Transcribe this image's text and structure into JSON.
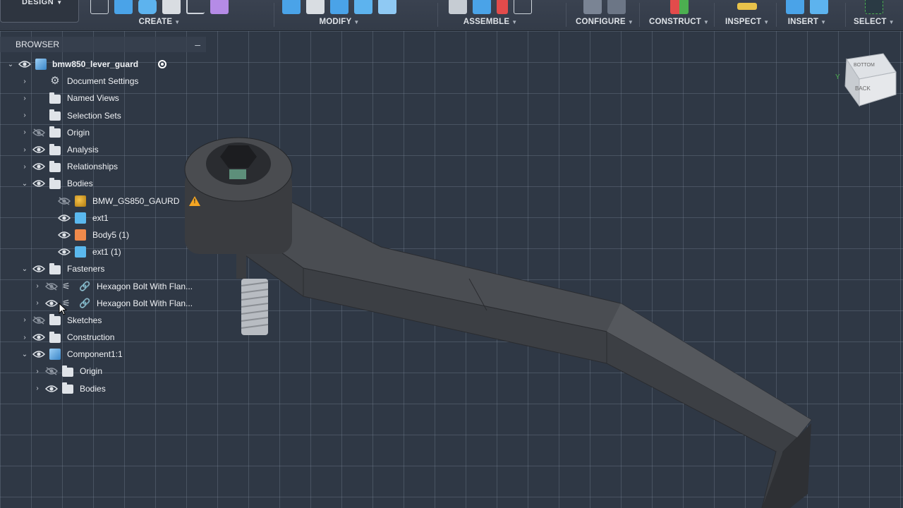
{
  "toolbar": {
    "design_label": "DESIGN",
    "groups": [
      {
        "label": "CREATE"
      },
      {
        "label": "MODIFY"
      },
      {
        "label": "ASSEMBLE"
      },
      {
        "label": "CONFIGURE"
      },
      {
        "label": "CONSTRUCT"
      },
      {
        "label": "INSPECT"
      },
      {
        "label": "INSERT"
      },
      {
        "label": "SELECT"
      }
    ]
  },
  "browser": {
    "title": "BROWSER",
    "collapse_symbol": "–",
    "root": {
      "label": "bmw850_lever_guard"
    },
    "items": [
      {
        "label": "Document Settings",
        "icon": "gear-icon"
      },
      {
        "label": "Named Views",
        "icon": "folder-icon"
      },
      {
        "label": "Selection Sets",
        "icon": "folder-icon"
      },
      {
        "label": "Origin",
        "icon": "folder-icon",
        "visible": false
      },
      {
        "label": "Analysis",
        "icon": "folder-icon"
      },
      {
        "label": "Relationships",
        "icon": "folder-icon"
      },
      {
        "label": "Bodies",
        "icon": "folder-icon",
        "expanded": true
      },
      {
        "label": "BMW_GS850_GAURD",
        "icon": "body-icon",
        "visible": false,
        "warning": true
      },
      {
        "label": "ext1",
        "icon": "body-icon"
      },
      {
        "label": "Body5 (1)",
        "icon": "body-icon"
      },
      {
        "label": "ext1 (1)",
        "icon": "body-icon"
      },
      {
        "label": "Fasteners",
        "icon": "folder-icon",
        "expanded": true
      },
      {
        "label": "Hexagon Bolt With Flan...",
        "icon": "fastener-icon",
        "visible": false
      },
      {
        "label": "Hexagon Bolt With Flan...",
        "icon": "fastener-icon"
      },
      {
        "label": "Sketches",
        "icon": "folder-icon",
        "visible": false
      },
      {
        "label": "Construction",
        "icon": "folder-icon"
      },
      {
        "label": "Component1:1",
        "icon": "component-icon",
        "expanded": true
      },
      {
        "label": "Origin",
        "icon": "folder-icon",
        "visible": false
      },
      {
        "label": "Bodies",
        "icon": "folder-icon"
      }
    ]
  },
  "viewcube": {
    "faces": [
      "BOTTOM",
      "BACK"
    ],
    "axis_label": "Y"
  },
  "colors": {
    "accent": "#2e8bd6",
    "warning": "#f5a623",
    "body_blue": "#5ab8ee",
    "body_orange": "#f08a4b"
  }
}
